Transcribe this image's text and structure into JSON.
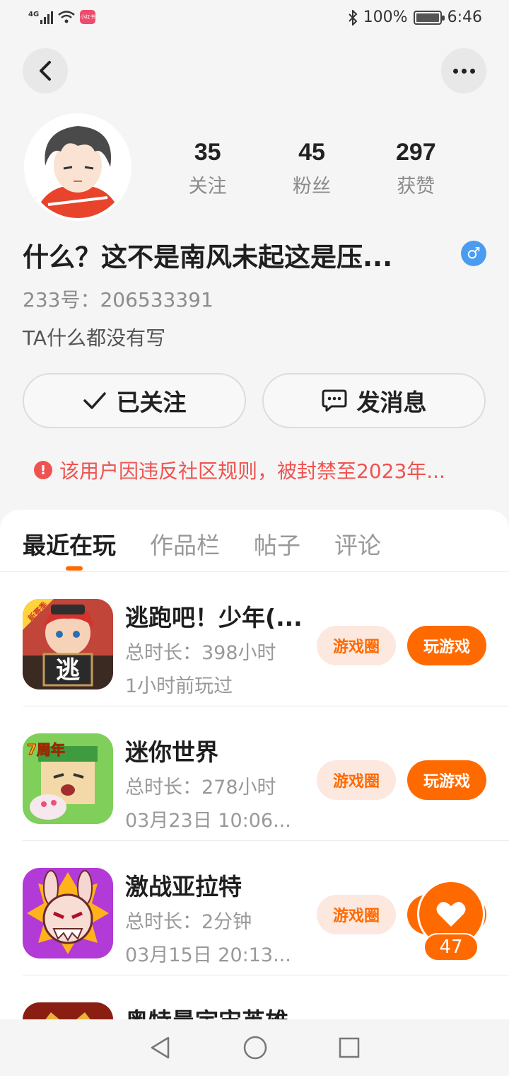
{
  "status_bar": {
    "network": "4G",
    "app_badge": "小红书",
    "battery": "100%",
    "time": "6:46"
  },
  "header": {
    "back_icon": "chevron-left-icon",
    "more_icon": "more-horizontal-icon"
  },
  "profile": {
    "stats": [
      {
        "value": "35",
        "label": "关注"
      },
      {
        "value": "45",
        "label": "粉丝"
      },
      {
        "value": "297",
        "label": "获赞"
      }
    ],
    "name": "什么？这不是南风未起这是压...",
    "gender_symbol": "♂",
    "uid": "233号：206533391",
    "bio": "TA什么都没有写",
    "follow_label": "已关注",
    "message_label": "发消息",
    "ban_notice": "该用户因违反社区规则，被封禁至2023年..."
  },
  "tabs": [
    {
      "label": "最近在玩",
      "active": true
    },
    {
      "label": "作品栏",
      "active": false
    },
    {
      "label": "帖子",
      "active": false
    },
    {
      "label": "评论",
      "active": false
    }
  ],
  "games": [
    {
      "name": "逃跑吧！少年(...",
      "duration": "总时长：398小时",
      "last_played": "1小时前玩过",
      "circle_label": "游戏圈",
      "play_label": "玩游戏",
      "icon_text": "逃",
      "icon_badge": "新赛季"
    },
    {
      "name": "迷你世界",
      "duration": "总时长：278小时",
      "last_played": "03月23日 10:06...",
      "circle_label": "游戏圈",
      "play_label": "玩游戏",
      "icon_badge": "7周年"
    },
    {
      "name": "激战亚拉特",
      "duration": "总时长：2分钟",
      "last_played": "03月15日 20:13...",
      "circle_label": "游戏圈",
      "play_label": "玩游戏"
    },
    {
      "name": "奥特曼宇宙英雄",
      "duration": "",
      "last_played": "",
      "circle_label": "",
      "play_label": ""
    }
  ],
  "like": {
    "count": "47"
  },
  "colors": {
    "accent": "#ff6a00",
    "danger": "#ef5350",
    "gender": "#4a9cf0"
  }
}
